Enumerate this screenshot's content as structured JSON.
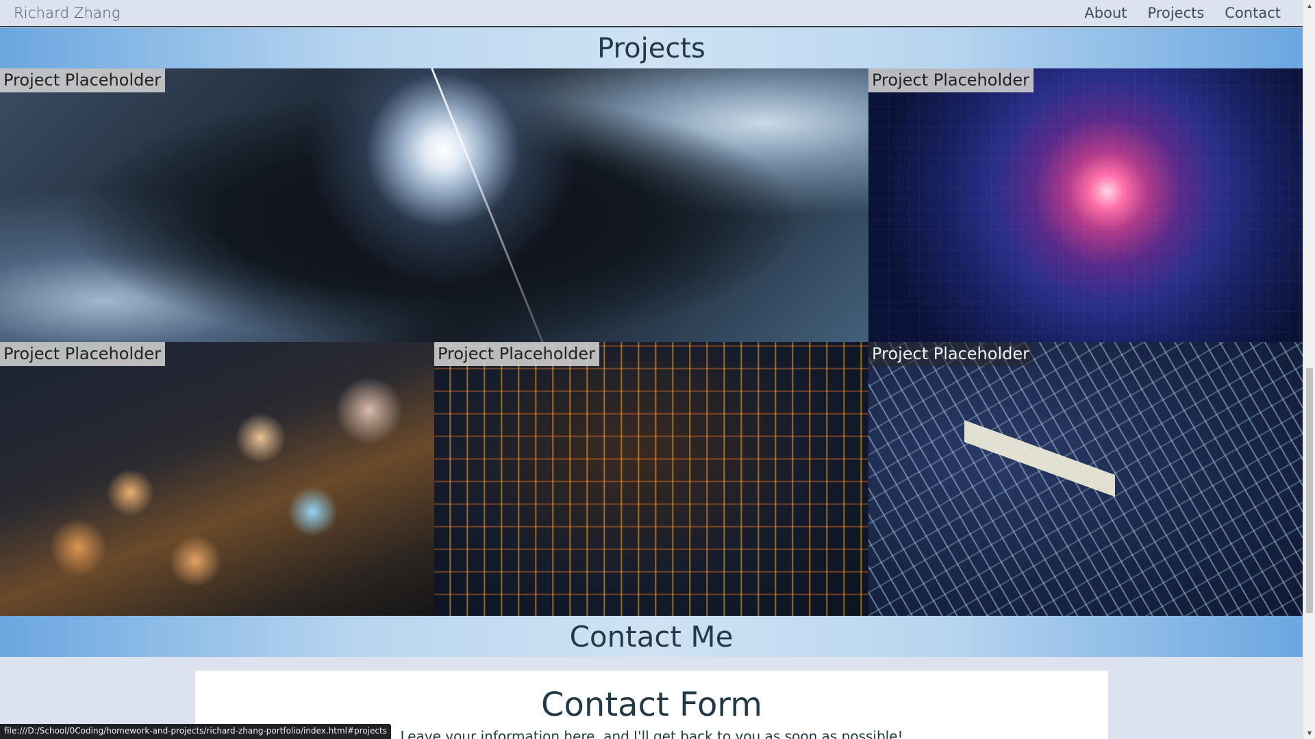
{
  "navbar": {
    "brand": "Richard Zhang",
    "links": [
      "About",
      "Projects",
      "Contact"
    ]
  },
  "projects": {
    "heading": "Projects",
    "tiles": [
      {
        "label": "Project Placeholder",
        "image": "space-nebula"
      },
      {
        "label": "Project Placeholder",
        "image": "neon-tunnel"
      },
      {
        "label": "Project Placeholder",
        "image": "city-bokeh"
      },
      {
        "label": "Project Placeholder",
        "image": "orange-circuit"
      },
      {
        "label": "Project Placeholder",
        "image": "blue-circuit-board"
      }
    ]
  },
  "contact": {
    "heading": "Contact Me",
    "form_title": "Contact Form",
    "form_subtitle": "Leave your information here, and I'll get back to you as soon as possible!"
  },
  "status_bar": {
    "url": "file:///D:/School/0Coding/homework-and-projects/richard-zhang-portfolio/index.html#projects"
  },
  "colors": {
    "header_gradient_edge": "#6aa6e0",
    "header_gradient_center": "#cfe2f4",
    "page_background": "#dde3ee",
    "text": "#223a47"
  }
}
